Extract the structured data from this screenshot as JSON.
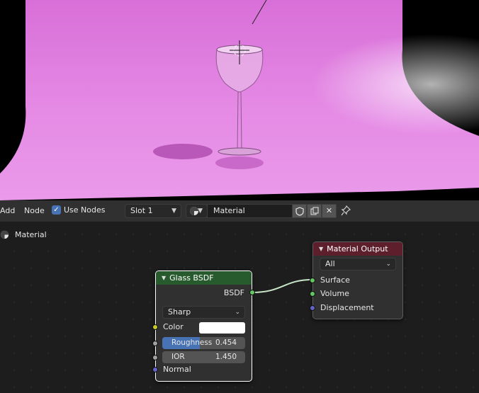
{
  "header": {
    "menu_add": "Add",
    "menu_node": "Node",
    "use_nodes_label": "Use Nodes",
    "use_nodes_checked": true,
    "slot_value": "Slot 1",
    "material_name": "Material"
  },
  "breadcrumb": {
    "label": "Material"
  },
  "nodes": {
    "glass": {
      "title": "Glass BSDF",
      "header_color": "#275b2d",
      "output_label": "BSDF",
      "distribution": "Sharp",
      "color_label": "Color",
      "color_value": "#ffffff",
      "roughness_label": "Roughness",
      "roughness_value": "0.454",
      "roughness_fraction": 0.454,
      "ior_label": "IOR",
      "ior_value": "1.450",
      "normal_label": "Normal"
    },
    "output": {
      "title": "Material Output",
      "header_color": "#5e1f2c",
      "target": "All",
      "surface_label": "Surface",
      "volume_label": "Volume",
      "displacement_label": "Displacement"
    }
  },
  "colors": {
    "socket_shader": "#63c763",
    "socket_color": "#c7c729",
    "socket_float": "#a1a1a1",
    "socket_vector": "#6363c7",
    "accent": "#4772b3",
    "backdrop": "#e07fe0"
  }
}
